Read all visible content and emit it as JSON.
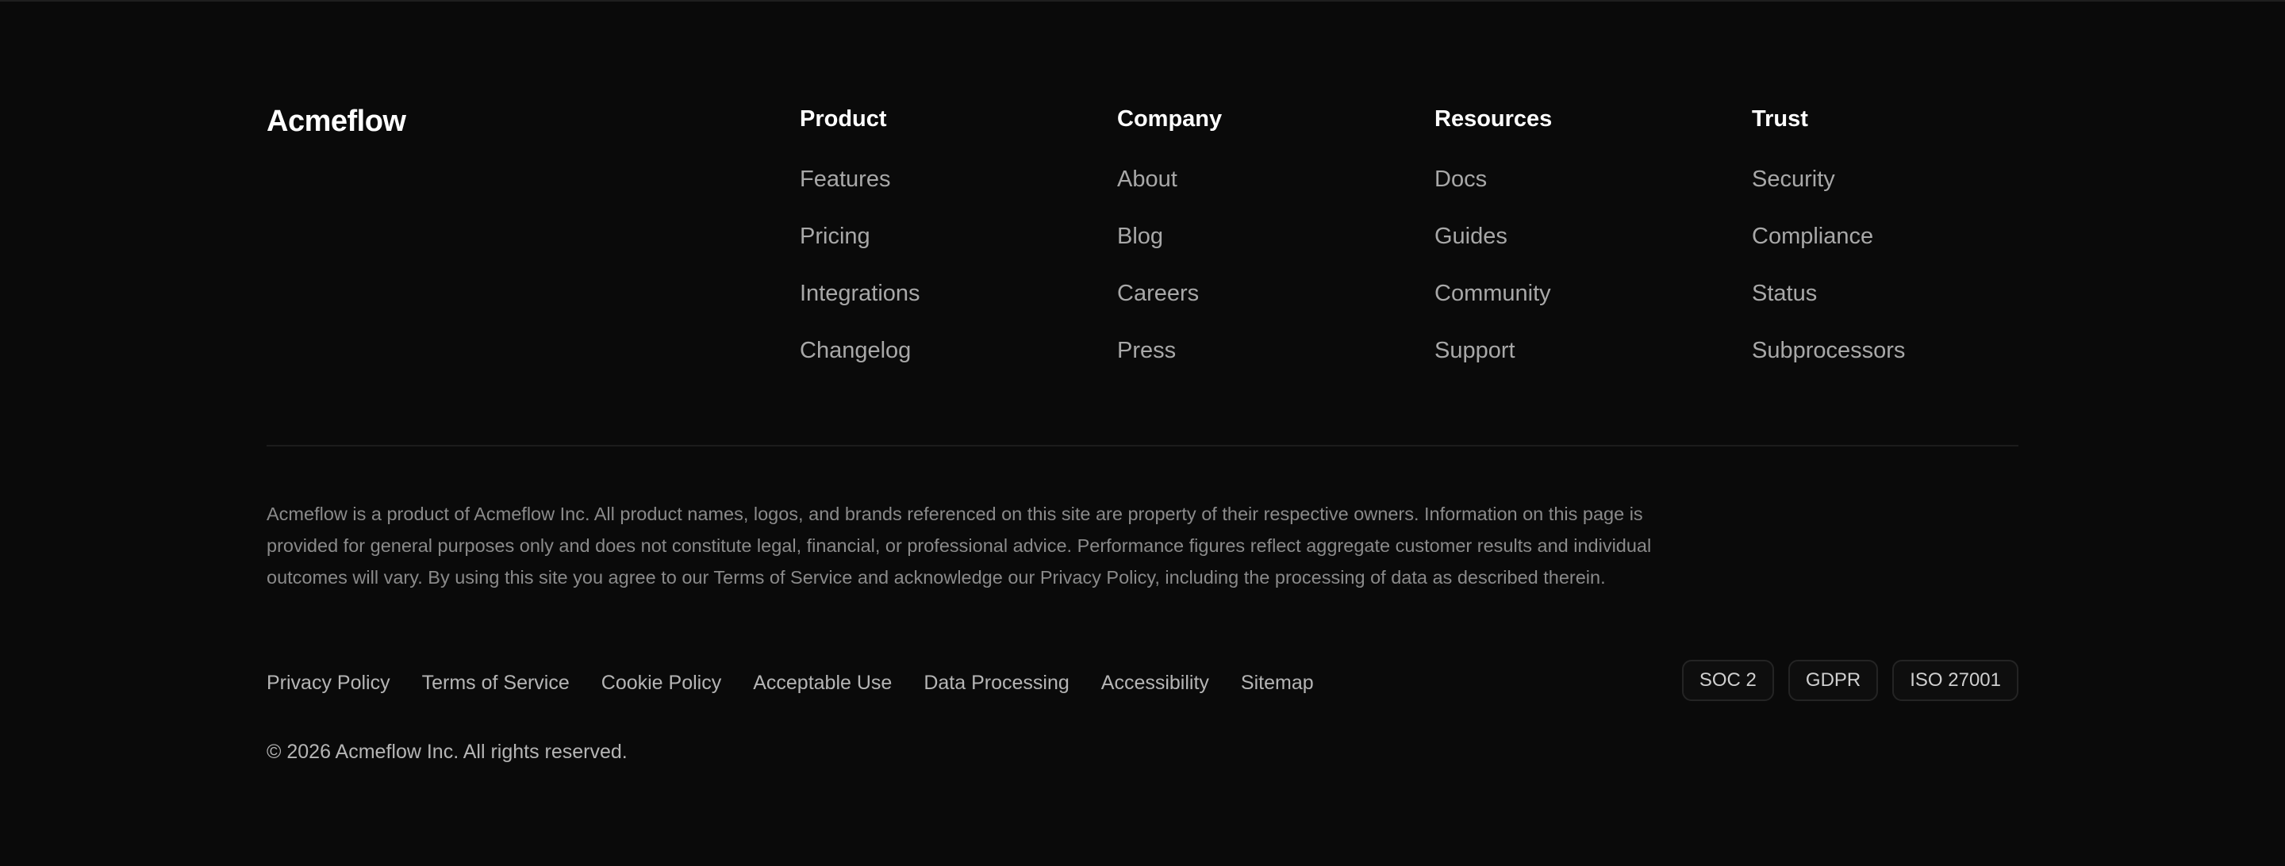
{
  "brand": "Acmeflow",
  "columns": [
    {
      "title": "Product",
      "links": [
        "Features",
        "Pricing",
        "Integrations",
        "Changelog"
      ]
    },
    {
      "title": "Company",
      "links": [
        "About",
        "Blog",
        "Careers",
        "Press"
      ]
    },
    {
      "title": "Resources",
      "links": [
        "Docs",
        "Guides",
        "Community",
        "Support"
      ]
    },
    {
      "title": "Trust",
      "links": [
        "Security",
        "Compliance",
        "Status",
        "Subprocessors"
      ]
    }
  ],
  "disclaimer": "Acmeflow is a product of Acmeflow Inc. All product names, logos, and brands referenced on this site are property of their respective owners. Information on this page is provided for general purposes only and does not constitute legal, financial, or professional advice. Performance figures reflect aggregate customer results and individual outcomes will vary. By using this site you agree to our Terms of Service and acknowledge our Privacy Policy, including the processing of data as described therein.",
  "legal_links": [
    "Privacy Policy",
    "Terms of Service",
    "Cookie Policy",
    "Acceptable Use",
    "Data Processing",
    "Accessibility",
    "Sitemap"
  ],
  "badges": [
    "SOC 2",
    "GDPR",
    "ISO 27001"
  ],
  "copyright": "© 2026 Acmeflow Inc. All rights reserved."
}
